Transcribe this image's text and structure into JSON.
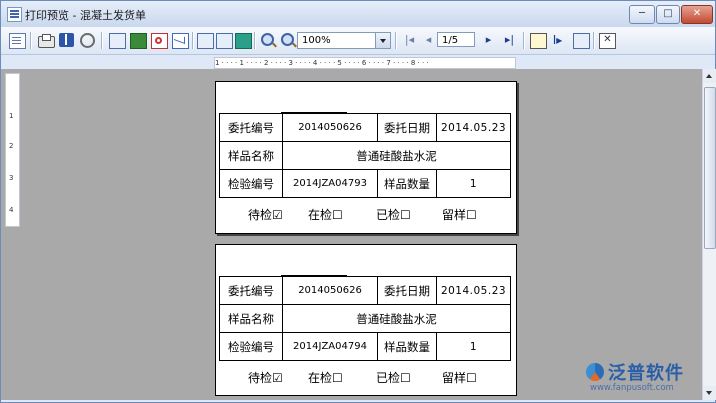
{
  "window": {
    "title": "打印预览 - 混凝土发货单",
    "controls": {
      "minimize": "─",
      "maximize": "□",
      "close": "✕"
    }
  },
  "toolbar": {
    "zoom": "100%",
    "page_indicator": "1/5",
    "nav_first": "|◂",
    "nav_prev": "◂",
    "nav_next": "▸",
    "nav_last": "▸|",
    "cursor_glyph": "I▸",
    "close_glyph": "✕"
  },
  "ruler": {
    "h_text": "1 · · · · 1 · · · · 2 · · · · 3 · · · · 4 · · · · 5 · · · · 6 · · · · 7 · · · · 8 · · ·",
    "v_marks": [
      "1",
      "2",
      "3",
      "4"
    ]
  },
  "pages": [
    {
      "labels": {
        "entrust_no": "委托编号",
        "entrust_date": "委托日期",
        "sample_name": "样品名称",
        "test_no": "检验编号",
        "sample_qty": "样品数量"
      },
      "values": {
        "entrust_no": "2014050626",
        "entrust_date": "2014.05.23",
        "sample_name": "普通硅酸盐水泥",
        "test_no": "2014JZA04793",
        "sample_qty": "1"
      },
      "status": {
        "pending": "待检☑",
        "testing": "在检☐",
        "tested": "已检☐",
        "retained": "留样☐"
      }
    },
    {
      "labels": {
        "entrust_no": "委托编号",
        "entrust_date": "委托日期",
        "sample_name": "样品名称",
        "test_no": "检验编号",
        "sample_qty": "样品数量"
      },
      "values": {
        "entrust_no": "2014050626",
        "entrust_date": "2014.05.23",
        "sample_name": "普通硅酸盐水泥",
        "test_no": "2014JZA04794",
        "sample_qty": "1"
      },
      "status": {
        "pending": "待检☑",
        "testing": "在检☐",
        "tested": "已检☐",
        "retained": "留样☐"
      }
    }
  ],
  "watermark": {
    "brand": "泛普软件",
    "url": "www.fanpusoft.com"
  },
  "colors": {
    "accent": "#2a5fa8",
    "title_bar": "#c9d8ee",
    "workspace": "#a9a9a9"
  }
}
